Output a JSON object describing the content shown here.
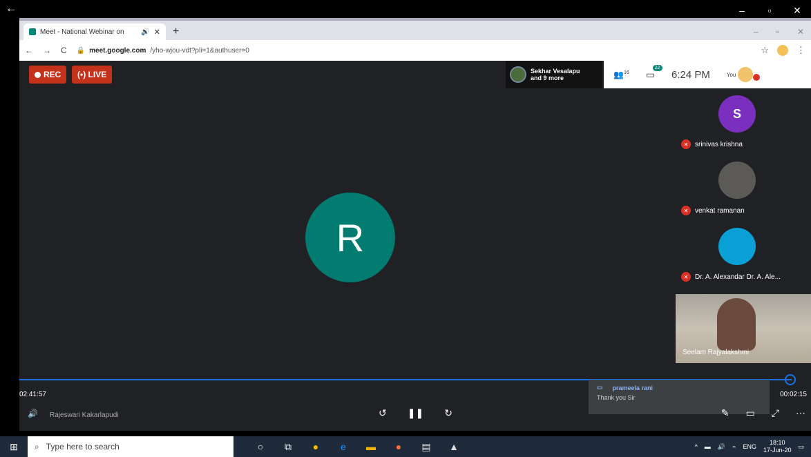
{
  "window": {
    "back_icon": "back-arrow-icon",
    "minimize": "–",
    "maximize": "▫",
    "close": "✕"
  },
  "tab": {
    "title": "Meet - National Webinar on",
    "close": "✕",
    "new_tab": "+",
    "sound_icon": "🔊"
  },
  "address": {
    "url_host": "meet.google.com",
    "url_path": "/yho-wjou-vdt?pli=1&authuser=0"
  },
  "meet": {
    "rec_label": "REC",
    "live_label": "LIVE",
    "notification": {
      "line1": "Sekhar Vesalapu",
      "line2": "and 9 more"
    },
    "people_count": "16",
    "chat_count": "22",
    "clock": "6:24 PM",
    "you_label": "You",
    "main_avatar_letter": "R",
    "participants": [
      {
        "initial": "S",
        "name": "srinivas krishna",
        "color": "#7b2fbe"
      },
      {
        "initial": "",
        "name": "venkat ramanan",
        "color": "#5b5a57"
      },
      {
        "initial": "",
        "name": "Dr. A. Alexandar Dr. A. Ale...",
        "color": "#0aa0d6"
      }
    ],
    "camera_name": "Seelam Rajyalakshmi"
  },
  "player": {
    "elapsed": "02:41:57",
    "remaining": "00:02:15",
    "speaker": "Rajeswari Kakarlapudi",
    "chat_popup": {
      "sender": "prameela rani",
      "message": "Thank you Sir"
    }
  },
  "taskbar": {
    "search_placeholder": "Type here to search",
    "lang": "ENG",
    "time": "18:10",
    "date": "17-Jun-20"
  }
}
